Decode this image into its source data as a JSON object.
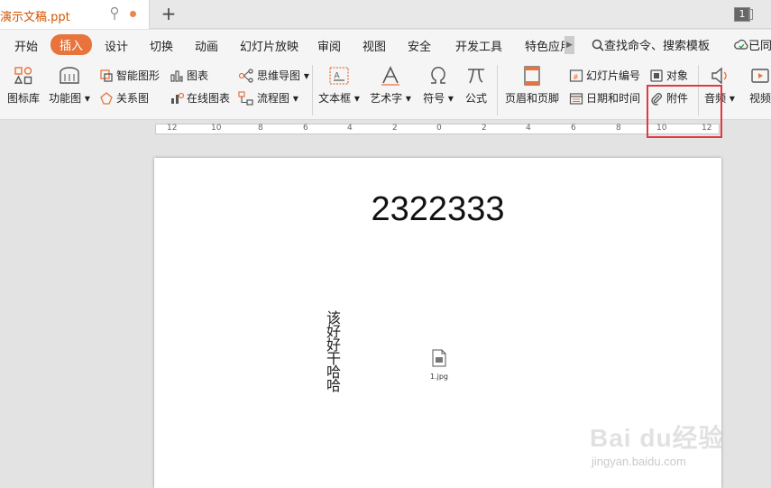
{
  "titlebar": {
    "doc_name": "演示文稿.ppt",
    "new_tab": "+",
    "window_count": "1"
  },
  "menu": {
    "items": [
      "开始",
      "插入",
      "设计",
      "切换",
      "动画",
      "幻灯片放映",
      "审阅",
      "视图",
      "安全",
      "开发工具",
      "特色应用"
    ],
    "active_index": 1,
    "search": "查找命令、搜索模板",
    "cloud": "已同"
  },
  "ribbon": {
    "icon_library": "图标库",
    "function_chart": "功能图",
    "smart_shape": "智能图形",
    "relation_chart": "关系图",
    "chart": "图表",
    "online_chart": "在线图表",
    "mind_map": "思维导图",
    "flow_chart": "流程图",
    "text_box": "文本框",
    "art_text": "艺术字",
    "symbol": "符号",
    "formula": "公式",
    "header_footer": "页眉和页脚",
    "slide_number": "幻灯片编号",
    "date_time": "日期和时间",
    "object": "对象",
    "attachment": "附件",
    "audio": "音频",
    "video": "视频"
  },
  "ruler": {
    "labels": [
      "12",
      "10",
      "8",
      "6",
      "4",
      "2",
      "0",
      "2",
      "4",
      "6",
      "8",
      "10",
      "12"
    ]
  },
  "slide": {
    "title": "2322333",
    "vertical_text": "该好好干哈哈",
    "attachment_filename": "1.jpg"
  },
  "watermark": {
    "brand": "Bai du经验",
    "url": "jingyan.baidu.com"
  },
  "colors": {
    "accent": "#e8743b",
    "highlight": "#e0393e"
  }
}
